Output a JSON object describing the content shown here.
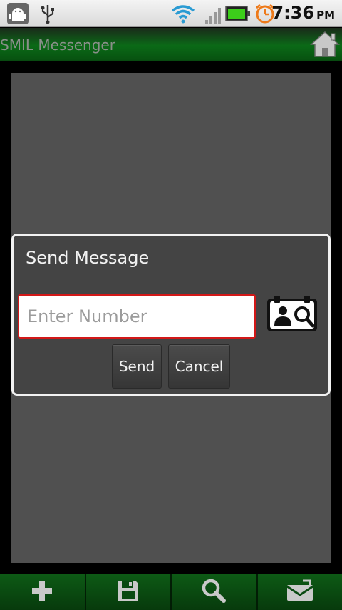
{
  "status_bar": {
    "time": "7:36",
    "ampm": "PM",
    "icons": [
      "android-debug-icon",
      "usb-icon",
      "wifi-icon",
      "signal-icon",
      "battery-icon",
      "alarm-icon"
    ]
  },
  "app": {
    "title": "SMIL Messenger"
  },
  "dialog": {
    "title": "Send Message",
    "input": {
      "value": "",
      "placeholder": "Enter Number"
    },
    "buttons": {
      "send": "Send",
      "cancel": "Cancel"
    }
  },
  "bottom_bar": {
    "items": [
      "add-icon",
      "save-icon",
      "search-icon",
      "mail-icon"
    ]
  },
  "colors": {
    "title_bar": "#0b6a17",
    "dialog_bg": "#444444",
    "input_border": "#d21818",
    "content_bg": "#505050"
  }
}
